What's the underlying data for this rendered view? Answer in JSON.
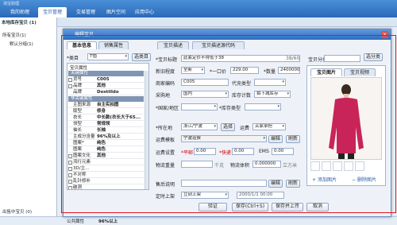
{
  "app": {
    "name": "淘宝助理",
    "tabs": [
      "我的助理",
      "宝贝管理",
      "交易管理",
      "图片空间",
      "应用中心"
    ],
    "active_tab": "宝贝管理"
  },
  "left_tree": {
    "items": [
      "所有宝贝(1)",
      "默认分组(1)"
    ],
    "header": "本地库存宝贝 (1)"
  },
  "status_bar": {
    "left": "出售中宝贝 (0)",
    "mid": "公共属性",
    "mid_value": "96%以上"
  },
  "dialog": {
    "title": "编辑宝贝",
    "tabs": [
      "基本信息",
      "销售属性",
      "宝贝描述",
      "宝贝描述源代码"
    ],
    "category": {
      "label": "*类目",
      "value": "T恤",
      "btn": "选类目"
    },
    "attr_header": "宝贝属性",
    "attr_rows": [
      {
        "group": "关键属性"
      },
      {
        "k": "货号",
        "v": "C005",
        "chk": true
      },
      {
        "k": "品牌",
        "v": "其他",
        "chk": true
      },
      {
        "k": "品牌",
        "v": "Dostilldo"
      },
      {
        "group": "非关键属性"
      },
      {
        "k": "主图来源",
        "v": "自主实拍图"
      },
      {
        "k": "版型",
        "v": "修身"
      },
      {
        "k": "衣长",
        "v": "中长款(衣长大于65..."
      },
      {
        "k": "领型",
        "v": "常规领"
      },
      {
        "k": "袖长",
        "v": "长袖"
      },
      {
        "k": "主成分含量",
        "v": "96%及以上"
      },
      {
        "k": "图案*",
        "v": "纯色"
      },
      {
        "k": "图案",
        "v": "纯色"
      },
      {
        "k": "图案文化",
        "v": "其他",
        "chk": true
      },
      {
        "k": "流行元素",
        "v": "",
        "chk": true
      },
      {
        "k": "3D/立...",
        "v": "",
        "chk": true
      },
      {
        "k": "不对称",
        "v": "",
        "chk": true
      },
      {
        "k": "乱针修补",
        "v": "",
        "chk": true
      },
      {
        "k": "破洞",
        "v": "",
        "chk": true
      }
    ],
    "title_field": {
      "label": "*宝贝标题",
      "value": "此套定价不得低于38",
      "count": "38/60"
    },
    "new_old": {
      "label": "新旧程度",
      "value": "全新"
    },
    "price": {
      "label": "*一口价",
      "value": "229.00"
    },
    "quantity": {
      "label": "*数量",
      "value": "2400000"
    },
    "merchant_code": {
      "label": "商家编码",
      "value": "C005"
    },
    "rebate": {
      "label": "代充类型",
      "value": ""
    },
    "purchase_loc": {
      "label": "采购地",
      "value": "国内"
    },
    "stock_count": {
      "label": "库存计数",
      "value": "拍下减库存"
    },
    "region": {
      "label": "*国家/地区",
      "value": ""
    },
    "stock_type": {
      "label": "*库存类型",
      "value": ""
    },
    "location": {
      "label": "*所在地",
      "value": "浙江/宁波",
      "btn": "选择"
    },
    "shipping_label": "运费",
    "shipping_option": "买家承担",
    "shipping_template": {
      "label": "运费模板",
      "value": "宁波运费",
      "btn_edit": "编辑",
      "btn_refresh": "刷新"
    },
    "shipping_set": {
      "label": "运费设置",
      "ping": "*平邮",
      "ping_v": "0.00",
      "kuaidi": "*快递",
      "kuaidi_v": "0.00",
      "ems": "EMS",
      "ems_v": "0.00"
    },
    "wuliu": {
      "label": "物流重量",
      "unit": "千克",
      "volume": "物流体积",
      "volume_v": "0.000000",
      "vunit": "立方米"
    },
    "sku_label": "售后说明",
    "sku_edit": "编辑",
    "sku_refresh": "刷新",
    "listing": {
      "label": "定时上架",
      "value": "立刻上架",
      "date": "2000/1/1 00:00"
    },
    "shop_category": {
      "label": "宝贝分类",
      "btn": "选分类"
    },
    "image_tabs": [
      "宝贝图片",
      "宝贝视频"
    ],
    "add_image": "添加图片",
    "delete_image": "删除图片",
    "footer_buttons": [
      "验证",
      "保存(Ctrl+S)",
      "保存并上传",
      "取消"
    ]
  },
  "colors": {
    "accent": "#2b69b8",
    "highlight_frame": "#e8141b",
    "model_shirt": "#c8245a"
  }
}
